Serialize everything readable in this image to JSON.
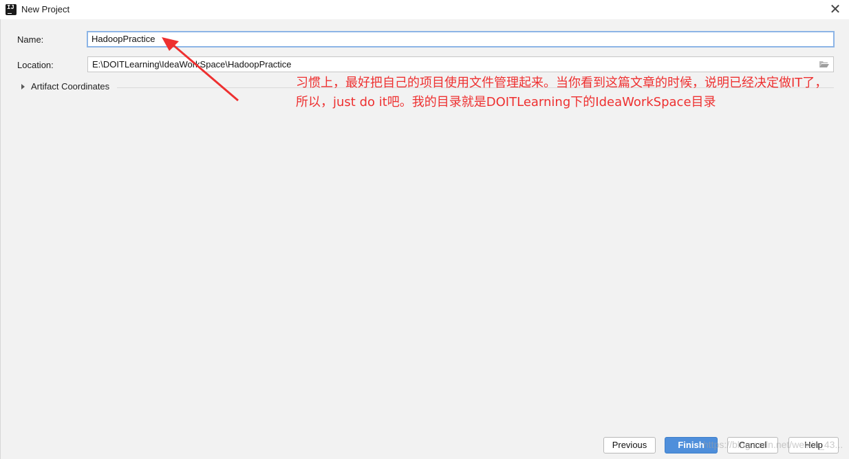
{
  "window": {
    "title": "New Project",
    "close": "✕"
  },
  "app_icon": {
    "text": "IJ",
    "icon": "intellij-idea-icon"
  },
  "form": {
    "name_label": "Name:",
    "name_value": "HadoopPractice",
    "location_label": "Location:",
    "location_value": "E:\\DOITLearning\\IdeaWorkSpace\\HadoopPractice",
    "browse_icon": "folder-open-icon",
    "artifact_label": "Artifact Coordinates"
  },
  "annotation": {
    "text": "习惯上，最好把自己的项目使用文件管理起来。当你看到这篇文章的时候，说明已经决定做IT了，所以，just do it吧。我的目录就是DOITLearning下的IdeaWorkSpace目录",
    "color": "#ee3030"
  },
  "buttons": {
    "previous": "Previous",
    "finish": "Finish",
    "cancel": "Cancel",
    "help": "Help"
  },
  "watermark": "https://blog.csdn.net/weixin_43..."
}
